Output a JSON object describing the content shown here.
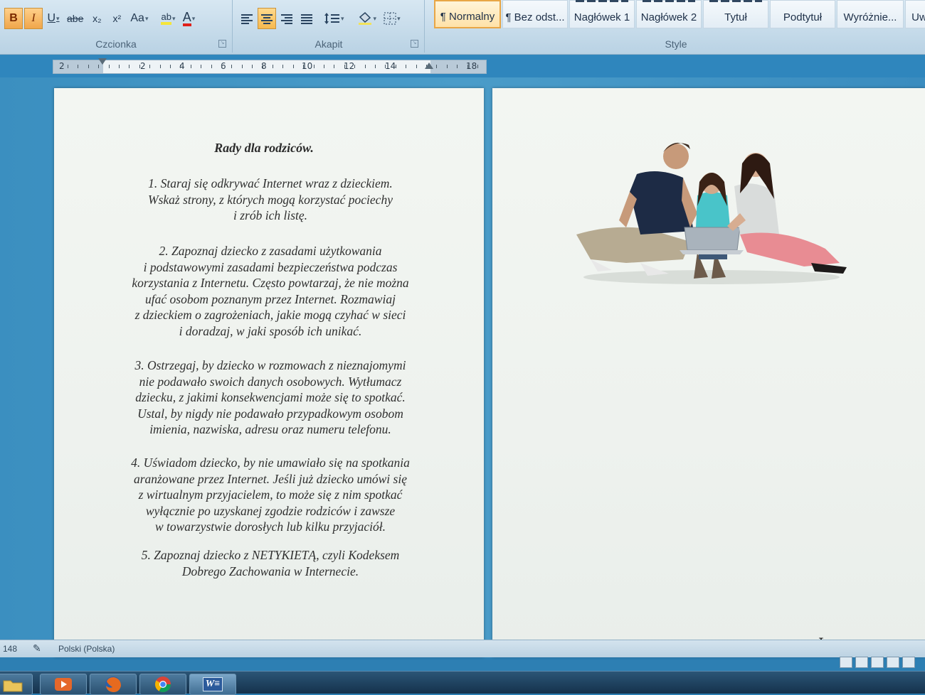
{
  "ribbon": {
    "font_group": {
      "label": "Czcionka",
      "bold": "B",
      "italic": "I",
      "underline": "U",
      "strike": "abe",
      "subscript": "x₂",
      "superscript": "x²",
      "change_case": "Aa",
      "highlight": "ab",
      "font_color": "A"
    },
    "paragraph_group": {
      "label": "Akapit"
    },
    "styles_group": {
      "label": "Style",
      "items": [
        "¶ Normalny",
        "¶ Bez odst...",
        "Nagłówek 1",
        "Nagłówek 2",
        "Tytuł",
        "Podtytuł",
        "Wyróżnie...",
        "Uw"
      ]
    }
  },
  "ruler": {
    "labels": [
      "2",
      "2",
      "4",
      "6",
      "8",
      "10",
      "12",
      "14",
      "18"
    ]
  },
  "document": {
    "title": "Rady dla rodziców.",
    "paragraphs": [
      {
        "lines": [
          "1. Staraj się odkrywać Internet wraz z dzieckiem.",
          "Wskaż strony, z których mogą korzystać pociechy",
          "i zrób ich listę."
        ]
      },
      {
        "lines": [
          "2. Zapoznaj dziecko z zasadami użytkowania",
          "i podstawowymi zasadami bezpieczeństwa podczas",
          "korzystania z Internetu. Często powtarzaj, że nie można",
          "ufać osobom poznanym przez Internet. Rozmawiaj",
          "z dzieckiem o zagrożeniach, jakie mogą czyhać w sieci",
          "i doradzaj, w jaki sposób ich unikać."
        ]
      },
      {
        "lines": [
          "3. Ostrzegaj, by dziecko w rozmowach z nieznajomymi",
          "nie podawało swoich danych osobowych. Wytłumacz",
          "dziecku, z jakimi konsekwencjami może się to spotkać.",
          "Ustal, by nigdy nie podawało przypadkowym osobom",
          "imienia, nazwiska, adresu oraz numeru telefonu."
        ]
      },
      {
        "lines": [
          "4. Uświadom dziecko, by nie umawiało się na spotkania",
          "aranżowane przez Internet. Jeśli już dziecko umówi się",
          "z wirtualnym przyjacielem, to może się z nim spotkać",
          "wyłącznie po uzyskanej zgodzie rodziców i zawsze",
          "w towarzystwie dorosłych lub kilku przyjaciół."
        ]
      },
      {
        "lines": [
          "5. Zapoznaj dziecko z NETYKIETĄ, czyli Kodeksem",
          "Dobrego Zachowania w Internecie."
        ]
      }
    ]
  },
  "statusbar": {
    "words": "148",
    "language": "Polski (Polska)"
  },
  "icons": {
    "taskbar": [
      "explorer-folder-icon",
      "media-player-icon",
      "firefox-icon",
      "chrome-icon",
      "word-icon"
    ],
    "word_label": "W≡"
  },
  "colors": {
    "accent": "#f0a64a",
    "ribbon": "#c8dcea",
    "workspace": "#3b8fc0"
  }
}
